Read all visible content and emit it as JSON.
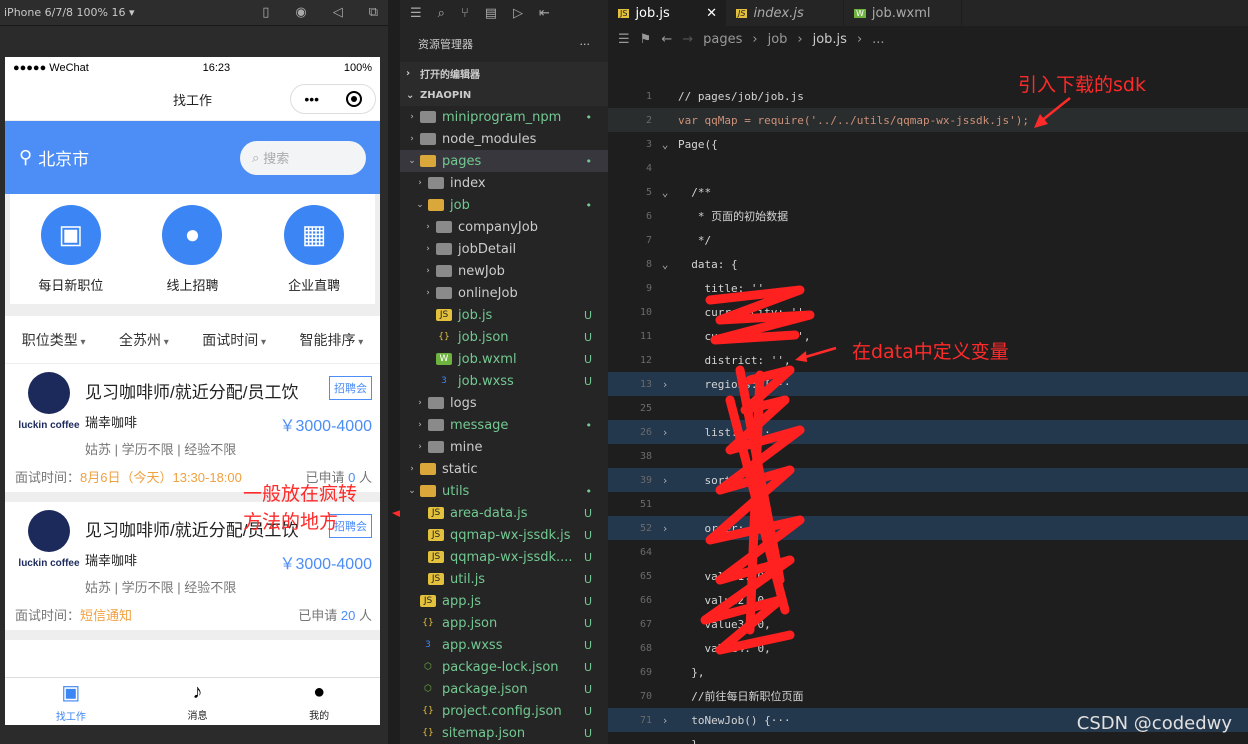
{
  "simulator": {
    "device": "iPhone 6/7/8 100% 16 ▾",
    "status": {
      "carrier": "●●●●● WeChat",
      "time": "16:23",
      "battery": "100%"
    },
    "nav_title": "找工作",
    "capsule_dots": "•••",
    "city": "北京市",
    "search_placeholder": "搜索",
    "categories": [
      {
        "label": "每日新职位",
        "icon": "briefcase-icon"
      },
      {
        "label": "线上招聘",
        "icon": "user-icon"
      },
      {
        "label": "企业直聘",
        "icon": "building-icon"
      }
    ],
    "filters": [
      "职位类型",
      "全苏州",
      "面试时间",
      "智能排序"
    ],
    "jobs": [
      {
        "brand": "luckin coffee",
        "title": "见习咖啡师/就近分配/员工饮",
        "badge": "招聘会",
        "company": "瑞幸咖啡",
        "salary": "￥3000-4000",
        "req": "姑苏 | 学历不限 | 经验不限",
        "time_label": "面试时间：",
        "time_value": "8月6日（今天）13:30-18:00",
        "applied_prefix": "已申请",
        "applied_count": "0",
        "applied_suffix": "人"
      },
      {
        "brand": "luckin coffee",
        "title": "见习咖啡师/就近分配/员工饮",
        "badge": "招聘会",
        "company": "瑞幸咖啡",
        "salary": "￥3000-4000",
        "req": "姑苏 | 学历不限 | 经验不限",
        "time_label": "面试时间：",
        "time_value": "短信通知",
        "applied_prefix": "已申请",
        "applied_count": "20",
        "applied_suffix": "人"
      }
    ],
    "tabbar": [
      {
        "label": "找工作",
        "icon": "briefcase-icon",
        "active": true
      },
      {
        "label": "消息",
        "icon": "bell-icon",
        "active": false
      },
      {
        "label": "我的",
        "icon": "user-icon",
        "active": false
      }
    ],
    "annotation": "一般放在疯转\n方法的地方"
  },
  "explorer": {
    "title": "资源管理器",
    "more": "···",
    "open_editors": "打开的编辑器",
    "project": "ZHAOPIN",
    "tree": [
      {
        "name": "miniprogram_npm",
        "type": "folder",
        "depth": 1,
        "twisty": "›",
        "status": "•"
      },
      {
        "name": "node_modules",
        "type": "folder",
        "depth": 1,
        "twisty": "›",
        "status": ""
      },
      {
        "name": "pages",
        "type": "open",
        "depth": 1,
        "twisty": "⌄",
        "status": "•",
        "selected": true
      },
      {
        "name": "index",
        "type": "folder",
        "depth": 2,
        "twisty": "›",
        "status": ""
      },
      {
        "name": "job",
        "type": "open",
        "depth": 2,
        "twisty": "⌄",
        "status": "•"
      },
      {
        "name": "companyJob",
        "type": "folder",
        "depth": 3,
        "twisty": "›",
        "status": ""
      },
      {
        "name": "jobDetail",
        "type": "folder",
        "depth": 3,
        "twisty": "›",
        "status": ""
      },
      {
        "name": "newJob",
        "type": "folder",
        "depth": 3,
        "twisty": "›",
        "status": ""
      },
      {
        "name": "onlineJob",
        "type": "folder",
        "depth": 3,
        "twisty": "›",
        "status": ""
      },
      {
        "name": "job.js",
        "type": "js",
        "depth": 3,
        "twisty": "",
        "status": "U"
      },
      {
        "name": "job.json",
        "type": "json",
        "depth": 3,
        "twisty": "",
        "status": "U"
      },
      {
        "name": "job.wxml",
        "type": "wxml",
        "depth": 3,
        "twisty": "",
        "status": "U"
      },
      {
        "name": "job.wxss",
        "type": "wxss",
        "depth": 3,
        "twisty": "",
        "status": "U"
      },
      {
        "name": "logs",
        "type": "folder",
        "depth": 2,
        "twisty": "›",
        "status": ""
      },
      {
        "name": "message",
        "type": "folder",
        "depth": 2,
        "twisty": "›",
        "status": "•"
      },
      {
        "name": "mine",
        "type": "folder",
        "depth": 2,
        "twisty": "›",
        "status": ""
      },
      {
        "name": "static",
        "type": "open",
        "depth": 1,
        "twisty": "›",
        "status": ""
      },
      {
        "name": "utils",
        "type": "open",
        "depth": 1,
        "twisty": "⌄",
        "status": "•"
      },
      {
        "name": "area-data.js",
        "type": "js",
        "depth": 2,
        "twisty": "",
        "status": "U"
      },
      {
        "name": "qqmap-wx-jssdk.js",
        "type": "js",
        "depth": 2,
        "twisty": "",
        "status": "U"
      },
      {
        "name": "qqmap-wx-jssdk....",
        "type": "js",
        "depth": 2,
        "twisty": "",
        "status": "U"
      },
      {
        "name": "util.js",
        "type": "js",
        "depth": 2,
        "twisty": "",
        "status": "U"
      },
      {
        "name": "app.js",
        "type": "js",
        "depth": 1,
        "twisty": "",
        "status": "U"
      },
      {
        "name": "app.json",
        "type": "json",
        "depth": 1,
        "twisty": "",
        "status": "U"
      },
      {
        "name": "app.wxss",
        "type": "wxss",
        "depth": 1,
        "twisty": "",
        "status": "U"
      },
      {
        "name": "package-lock.json",
        "type": "pkg",
        "depth": 1,
        "twisty": "",
        "status": "U"
      },
      {
        "name": "package.json",
        "type": "pkg",
        "depth": 1,
        "twisty": "",
        "status": "U"
      },
      {
        "name": "project.config.json",
        "type": "json",
        "depth": 1,
        "twisty": "",
        "status": "U"
      },
      {
        "name": "sitemap.json",
        "type": "json",
        "depth": 1,
        "twisty": "",
        "status": "U"
      }
    ]
  },
  "editor": {
    "tabs": [
      {
        "label": "job.js",
        "active": true,
        "badge": "JS",
        "close": "✕"
      },
      {
        "label": "index.js",
        "active": false,
        "badge": "JS",
        "close": ""
      },
      {
        "label": "job.wxml",
        "active": false,
        "badge": "W",
        "close": ""
      }
    ],
    "breadcrumb": [
      "pages",
      "job",
      "job.js",
      "..."
    ],
    "lines": [
      {
        "n": "1",
        "fold": "",
        "text": "// pages/job/job.js",
        "cls": "c-com",
        "hl": ""
      },
      {
        "n": "2",
        "fold": "",
        "text": "var qqMap = require('../../utils/qqmap-wx-jssdk.js');",
        "cls": "mix",
        "hl": "cur"
      },
      {
        "n": "3",
        "fold": "⌄",
        "text": "Page({",
        "cls": "c-fn",
        "hl": ""
      },
      {
        "n": "4",
        "fold": "",
        "text": "",
        "cls": "",
        "hl": ""
      },
      {
        "n": "5",
        "fold": "⌄",
        "text": "  /**",
        "cls": "c-com",
        "hl": ""
      },
      {
        "n": "6",
        "fold": "",
        "text": "   * 页面的初始数据",
        "cls": "c-com",
        "hl": ""
      },
      {
        "n": "7",
        "fold": "",
        "text": "   */",
        "cls": "c-com",
        "hl": ""
      },
      {
        "n": "8",
        "fold": "⌄",
        "text": "  data: {",
        "cls": "",
        "hl": ""
      },
      {
        "n": "9",
        "fold": "",
        "text": "    title: '',",
        "cls": "",
        "hl": ""
      },
      {
        "n": "10",
        "fold": "",
        "text": "    currentCity: '',",
        "cls": "",
        "hl": ""
      },
      {
        "n": "11",
        "fold": "",
        "text": "    currentArea: '',",
        "cls": "",
        "hl": ""
      },
      {
        "n": "12",
        "fold": "",
        "text": "    district: '',",
        "cls": "",
        "hl": ""
      },
      {
        "n": "13",
        "fold": "›",
        "text": "    regions: [···",
        "cls": "",
        "hl": "hl"
      },
      {
        "n": "25",
        "fold": "",
        "text": "    ",
        "cls": "",
        "hl": ""
      },
      {
        "n": "26",
        "fold": "›",
        "text": "    list: [···",
        "cls": "",
        "hl": "hl"
      },
      {
        "n": "38",
        "fold": "",
        "text": "",
        "cls": "",
        "hl": ""
      },
      {
        "n": "39",
        "fold": "›",
        "text": "    sort: [···",
        "cls": "",
        "hl": "hl"
      },
      {
        "n": "51",
        "fold": "",
        "text": "",
        "cls": "",
        "hl": ""
      },
      {
        "n": "52",
        "fold": "›",
        "text": "    order: [···",
        "cls": "",
        "hl": "hl"
      },
      {
        "n": "64",
        "fold": "",
        "text": "",
        "cls": "",
        "hl": ""
      },
      {
        "n": "65",
        "fold": "",
        "text": "    value1: 0,",
        "cls": "",
        "hl": ""
      },
      {
        "n": "66",
        "fold": "",
        "text": "    value2: 0,",
        "cls": "",
        "hl": ""
      },
      {
        "n": "67",
        "fold": "",
        "text": "    value3: 0,",
        "cls": "",
        "hl": ""
      },
      {
        "n": "68",
        "fold": "",
        "text": "    value4: 0,",
        "cls": "",
        "hl": ""
      },
      {
        "n": "69",
        "fold": "",
        "text": "  },",
        "cls": "",
        "hl": ""
      },
      {
        "n": "70",
        "fold": "",
        "text": "  //前往每日新职位页面",
        "cls": "c-com",
        "hl": ""
      },
      {
        "n": "71",
        "fold": "›",
        "text": "  toNewJob() {···",
        "cls": "c-fn",
        "hl": "hl"
      },
      {
        "n": "",
        "fold": "",
        "text": "  },",
        "cls": "",
        "hl": ""
      }
    ],
    "annotation_sdk": "引入下载的sdk",
    "annotation_data": "在data中定义变量",
    "watermark": "CSDN @codedwy"
  }
}
